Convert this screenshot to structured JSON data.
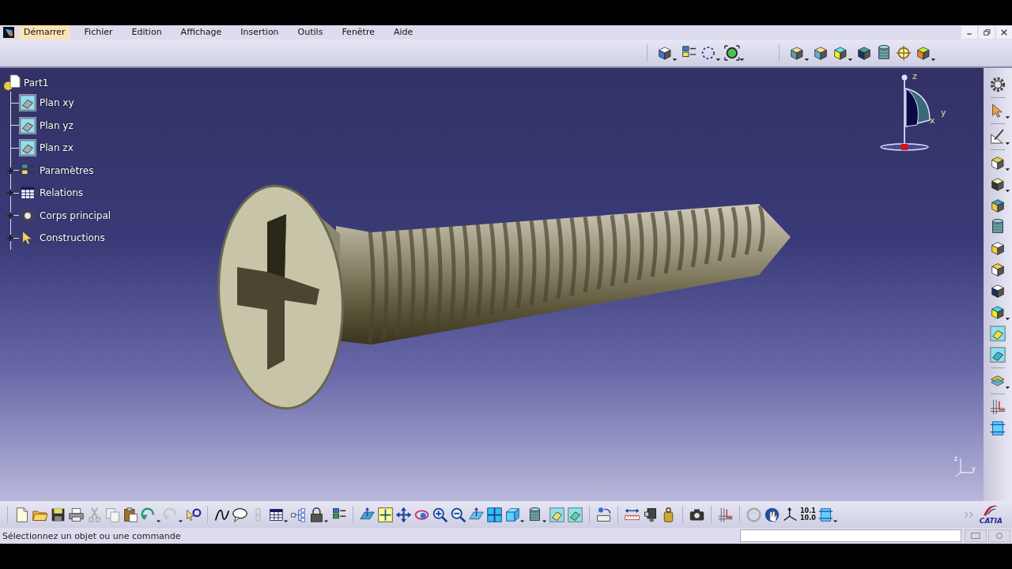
{
  "menu": [
    {
      "label": "Démarrer",
      "highlighted": true
    },
    {
      "label": "Fichier",
      "highlighted": false
    },
    {
      "label": "Edition",
      "highlighted": false
    },
    {
      "label": "Affichage",
      "highlighted": false
    },
    {
      "label": "Insertion",
      "highlighted": false
    },
    {
      "label": "Outils",
      "highlighted": false
    },
    {
      "label": "Fenêtre",
      "highlighted": false
    },
    {
      "label": "Aide",
      "highlighted": false
    }
  ],
  "tree": {
    "label": "Part1",
    "children": [
      {
        "label": "Plan xy",
        "kind": "plane"
      },
      {
        "label": "Plan yz",
        "kind": "plane"
      },
      {
        "label": "Plan zx",
        "kind": "plane"
      },
      {
        "label": "Paramètres",
        "kind": "parameters",
        "expanded": false
      },
      {
        "label": "Relations",
        "kind": "relations",
        "expanded": false
      },
      {
        "label": "Corps principal",
        "kind": "body",
        "expanded": false
      },
      {
        "label": "Constructions",
        "kind": "constructions",
        "expanded": false
      }
    ]
  },
  "compass": {
    "labels": [
      "z",
      "y",
      "x"
    ]
  },
  "mini_axis": {
    "labels": [
      "z",
      "y"
    ]
  },
  "toolbar_readout": [
    "10.1",
    "10.0"
  ],
  "logo": {
    "text": "CATIA"
  },
  "status_bar": {
    "message": "Sélectionnez un objet ou une commande"
  }
}
